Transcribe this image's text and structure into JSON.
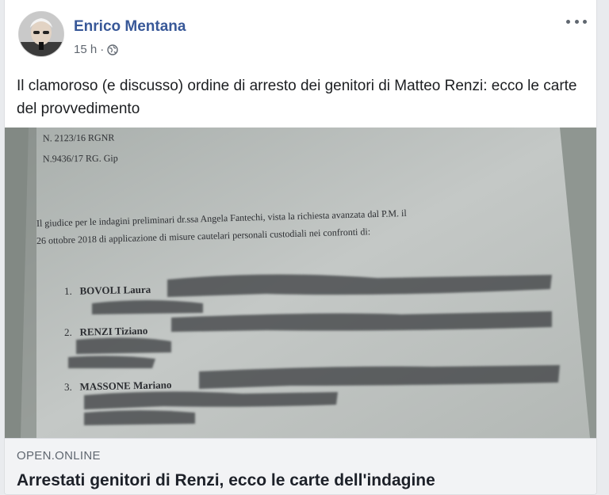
{
  "post": {
    "author": "Enrico Mentana",
    "timestamp": "15 h",
    "separator": "·",
    "privacy_icon": "globe-icon",
    "more_icon": "more-options-icon",
    "caption": "Il clamoroso (e discusso) ordine di arresto dei genitori di Matteo Renzi: ecco le carte del provvedimento"
  },
  "document": {
    "ref1": "N. 2123/16  RGNR",
    "ref2": "N.9436/17 RG. Gip",
    "line1": "Il giudice per le indagini preliminari dr.ssa  Angela Fantechi,  vista la richiesta avanzata dal P.M. il",
    "line2": "26 ottobre 2018 di applicazione di  misure cautelari personali custodiali nei confronti di:",
    "entries": [
      {
        "num": "1.",
        "name": "BOVOLI Laura"
      },
      {
        "num": "2.",
        "name": "RENZI Tiziano"
      },
      {
        "num": "3.",
        "name": "MASSONE Mariano"
      }
    ]
  },
  "link": {
    "domain": "OPEN.ONLINE",
    "title": "Arrestati genitori di Renzi, ecco le carte dell'indagine"
  },
  "colors": {
    "author": "#385898",
    "background": "#e9ebee",
    "link_box": "#f2f3f5"
  }
}
